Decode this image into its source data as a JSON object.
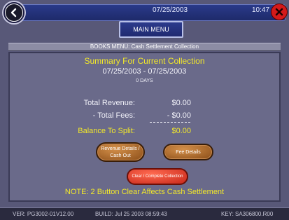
{
  "header": {
    "date": "07/25/2003",
    "time": "10:47"
  },
  "nav": {
    "main_menu_label": "MAIN MENU",
    "breadcrumb": "BOOKS MENU: Cash Settlement Collection"
  },
  "summary": {
    "title": "Summary For Current Collection",
    "date_range": "07/25/2003 - 07/25/2003",
    "days": "0 DAYS",
    "rows": [
      {
        "label": "Total Revenue:",
        "value": "$0.00"
      },
      {
        "label": "- Total Fees:",
        "value": "- $0.00"
      },
      {
        "label": "Balance To Split:",
        "value": "$0.00"
      }
    ]
  },
  "buttons": {
    "revenue_line1": "Revenue Details /",
    "revenue_line2": "Cash Out",
    "fee_details": "Fee Details",
    "clear_complete": "Clear / Complete Collection"
  },
  "note": "NOTE: 2 Button Clear Affects Cash Settlement",
  "footer": {
    "ver": "VER: PG3002-01V12.00",
    "build": "BUILD: Jul 25 2003  08:59:43",
    "key": "KEY: SA306800.R00"
  },
  "colors": {
    "accent_yellow": "#f2e82a",
    "background": "#585878",
    "close_red": "#d41a1a",
    "button_brown": "#b06a2a",
    "button_red": "#e84a30"
  },
  "icons": {
    "back": "back-arrow-icon",
    "close": "close-icon"
  }
}
